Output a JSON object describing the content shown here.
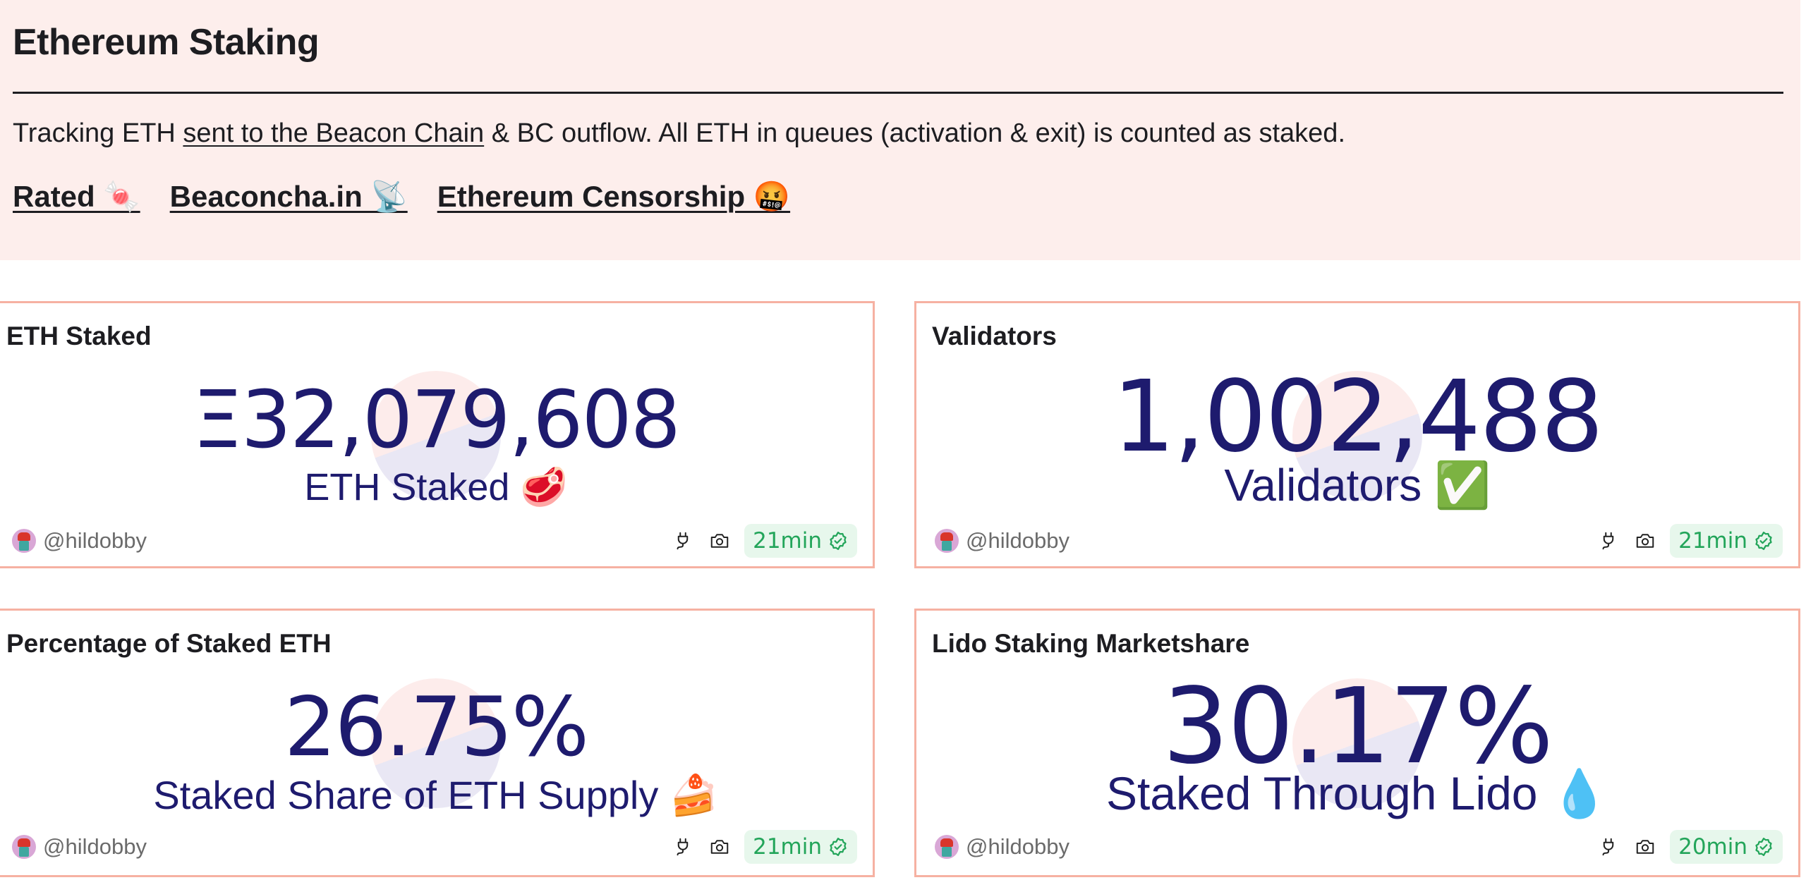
{
  "header": {
    "title": "Ethereum Staking",
    "description_prefix": "Tracking ETH ",
    "description_link": "sent to the Beacon Chain",
    "description_suffix": " & BC outflow. All ETH in queues (activation & exit) is counted as staked.",
    "links": [
      {
        "label": "Rated 🍬"
      },
      {
        "label": "Beaconcha.in 📡"
      },
      {
        "label": "Ethereum Censorship 🤬"
      }
    ]
  },
  "cards": [
    {
      "title": "ETH Staked",
      "value": "Ξ32,079,608",
      "subtitle": "ETH Staked 🥩",
      "author": "@hildobby",
      "freshness": "21min",
      "icons": [
        "plug-icon",
        "camera-icon",
        "verified-badge-icon"
      ]
    },
    {
      "title": "Validators",
      "value": "1,002,488",
      "subtitle": "Validators ✅",
      "author": "@hildobby",
      "freshness": "21min",
      "icons": [
        "plug-icon",
        "camera-icon",
        "verified-badge-icon"
      ]
    },
    {
      "title": "Percentage of Staked ETH",
      "value": "26.75%",
      "subtitle": "Staked Share of ETH Supply 🍰",
      "author": "@hildobby",
      "freshness": "21min",
      "icons": [
        "plug-icon",
        "camera-icon",
        "verified-badge-icon"
      ]
    },
    {
      "title": "Lido Staking Marketshare",
      "value": "30.17%",
      "subtitle": "Staked Through Lido 💧",
      "author": "@hildobby",
      "freshness": "20min",
      "icons": [
        "plug-icon",
        "camera-icon",
        "verified-badge-icon"
      ]
    }
  ],
  "colors": {
    "header_bg": "#fdeeec",
    "card_border": "#f6b1a2",
    "value_color": "#1e1b6e",
    "freshness_bg": "#e7f7ec",
    "freshness_text": "#23a55a"
  }
}
